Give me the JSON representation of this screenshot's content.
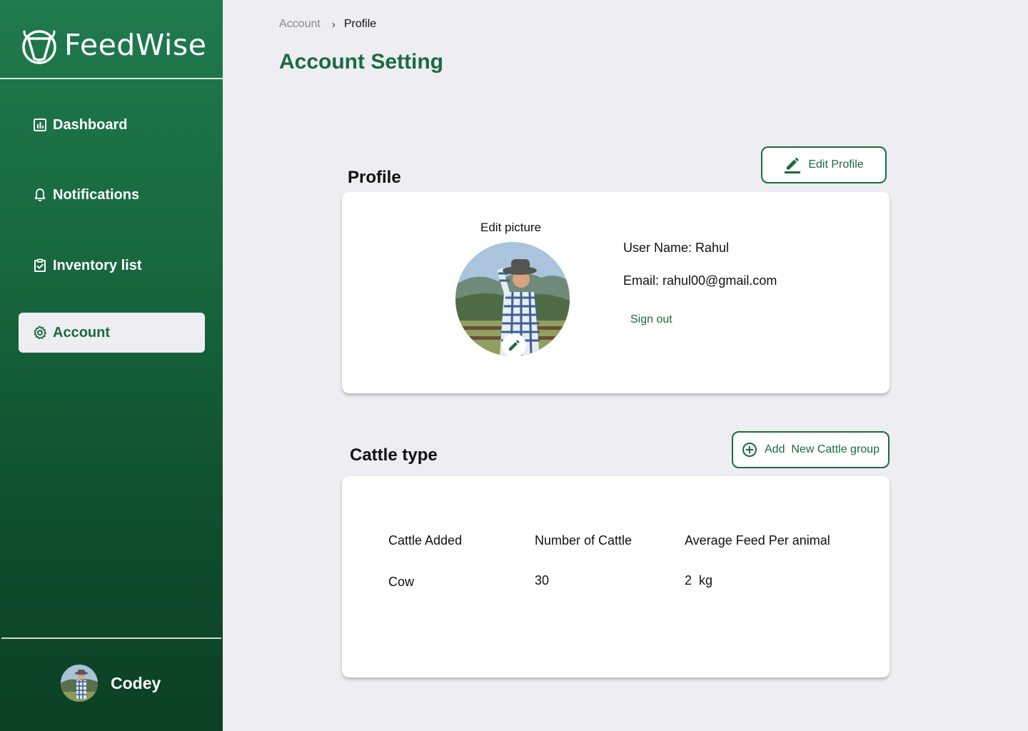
{
  "brand": {
    "name": "FeedWise"
  },
  "sidebar": {
    "items": [
      {
        "label": "Dashboard",
        "icon": "chart-icon"
      },
      {
        "label": "Notifications",
        "icon": "bell-icon"
      },
      {
        "label": "Inventory list",
        "icon": "clipboard-check-icon"
      },
      {
        "label": "Account",
        "icon": "gear-icon",
        "active": true
      }
    ],
    "user": {
      "name": "Codey"
    }
  },
  "breadcrumb": {
    "root": "Account",
    "current": "Profile"
  },
  "page": {
    "title": "Account Setting"
  },
  "profile": {
    "section_title": "Profile",
    "edit_button": "Edit Profile",
    "edit_picture_label": "Edit picture",
    "username_line": "User Name: Rahul",
    "email_line": "Email: rahul00@gmail.com",
    "signout_label": "Sign out"
  },
  "cattle": {
    "section_title": "Cattle type",
    "add_button": "Add  New Cattle group",
    "columns": [
      "Cattle Added",
      "Number of Cattle",
      "Average Feed Per animal"
    ],
    "rows": [
      [
        "Cow",
        "30",
        "2  kg"
      ]
    ]
  },
  "colors": {
    "accent": "#1a6b40",
    "sidebar_top": "#1f7a4e",
    "sidebar_bottom": "#0c3f24",
    "background": "#ededf2"
  }
}
